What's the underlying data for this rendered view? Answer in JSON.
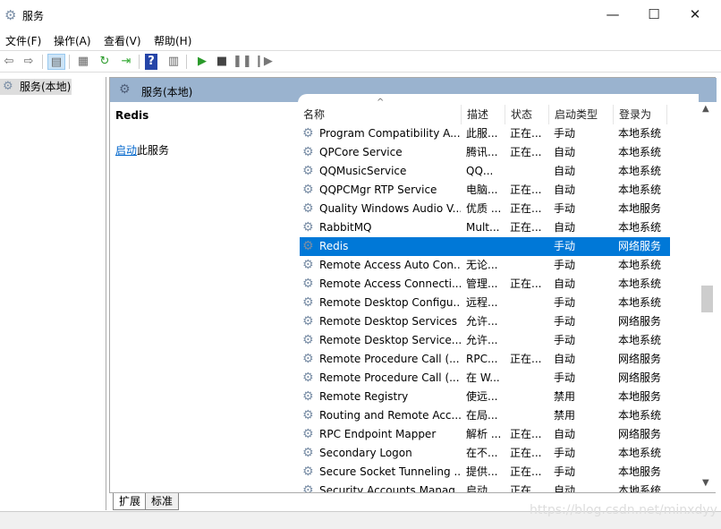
{
  "window": {
    "title": "服务",
    "minimize": "—",
    "maximize": "☐",
    "close": "✕"
  },
  "menu": [
    "文件(F)",
    "操作(A)",
    "查看(V)",
    "帮助(H)"
  ],
  "toolbar": {
    "icons": [
      "back-icon",
      "forward-icon",
      "show-hide-console-tree-icon",
      "properties-icon",
      "refresh-icon",
      "export-list-icon",
      "help-icon",
      "show-action-pane-icon",
      "start-service-icon",
      "stop-service-icon",
      "pause-service-icon",
      "resume-service-icon"
    ]
  },
  "tree": {
    "item": "服务(本地)"
  },
  "main": {
    "header": "服务(本地)",
    "selected_service": "Redis",
    "start_link": "启动",
    "start_suffix": "此服务",
    "columns": [
      "名称",
      "描述",
      "状态",
      "启动类型",
      "登录为"
    ],
    "sort_indicator": "^",
    "rows": [
      {
        "name": "Program Compatibility A...",
        "desc": "此服...",
        "status": "正在...",
        "startup": "手动",
        "logon": "本地系统"
      },
      {
        "name": "QPCore Service",
        "desc": "腾讯...",
        "status": "正在...",
        "startup": "自动",
        "logon": "本地系统"
      },
      {
        "name": "QQMusicService",
        "desc": "QQ...",
        "status": "",
        "startup": "自动",
        "logon": "本地系统"
      },
      {
        "name": "QQPCMgr RTP Service",
        "desc": "电脑...",
        "status": "正在...",
        "startup": "自动",
        "logon": "本地系统"
      },
      {
        "name": "Quality Windows Audio V...",
        "desc": "优质 ...",
        "status": "正在...",
        "startup": "手动",
        "logon": "本地服务"
      },
      {
        "name": "RabbitMQ",
        "desc": "Mult...",
        "status": "正在...",
        "startup": "自动",
        "logon": "本地系统"
      },
      {
        "name": "Redis",
        "desc": "",
        "status": "",
        "startup": "手动",
        "logon": "网络服务",
        "selected": true
      },
      {
        "name": "Remote Access Auto Con...",
        "desc": "无论...",
        "status": "",
        "startup": "手动",
        "logon": "本地系统"
      },
      {
        "name": "Remote Access Connecti...",
        "desc": "管理...",
        "status": "正在...",
        "startup": "自动",
        "logon": "本地系统"
      },
      {
        "name": "Remote Desktop Configu...",
        "desc": "远程...",
        "status": "",
        "startup": "手动",
        "logon": "本地系统"
      },
      {
        "name": "Remote Desktop Services",
        "desc": "允许...",
        "status": "",
        "startup": "手动",
        "logon": "网络服务"
      },
      {
        "name": "Remote Desktop Service...",
        "desc": "允许...",
        "status": "",
        "startup": "手动",
        "logon": "本地系统"
      },
      {
        "name": "Remote Procedure Call (...",
        "desc": "RPC...",
        "status": "正在...",
        "startup": "自动",
        "logon": "网络服务"
      },
      {
        "name": "Remote Procedure Call (...",
        "desc": "在 W...",
        "status": "",
        "startup": "手动",
        "logon": "网络服务"
      },
      {
        "name": "Remote Registry",
        "desc": "使远...",
        "status": "",
        "startup": "禁用",
        "logon": "本地服务"
      },
      {
        "name": "Routing and Remote Acc...",
        "desc": "在局...",
        "status": "",
        "startup": "禁用",
        "logon": "本地系统"
      },
      {
        "name": "RPC Endpoint Mapper",
        "desc": "解析 ...",
        "status": "正在...",
        "startup": "自动",
        "logon": "网络服务"
      },
      {
        "name": "Secondary Logon",
        "desc": "在不...",
        "status": "正在...",
        "startup": "手动",
        "logon": "本地系统"
      },
      {
        "name": "Secure Socket Tunneling ...",
        "desc": "提供...",
        "status": "正在...",
        "startup": "手动",
        "logon": "本地服务"
      },
      {
        "name": "Security Accounts Manag...",
        "desc": "启动...",
        "status": "正在...",
        "startup": "自动",
        "logon": "本地系统"
      }
    ]
  },
  "tabs": [
    "扩展",
    "标准"
  ],
  "watermark": "https://blog.csdn.net/minxdyy"
}
